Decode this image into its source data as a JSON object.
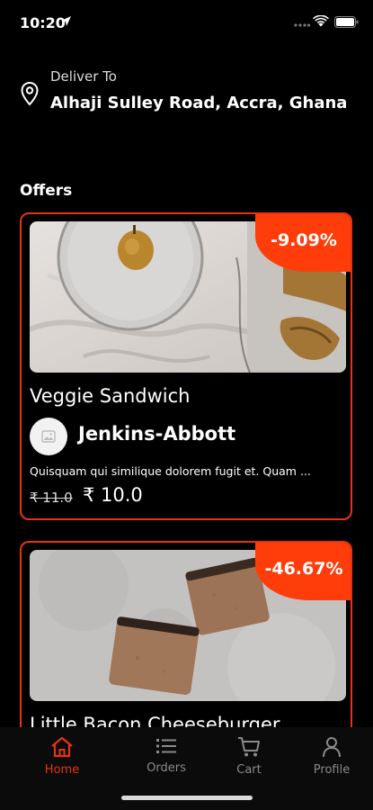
{
  "status": {
    "time": "10:20"
  },
  "deliver": {
    "label": "Deliver To",
    "address": "Alhaji Sulley Road, Accra, Ghana"
  },
  "offers": {
    "title": "Offers",
    "items": [
      {
        "discount": "-9.09%",
        "name": "Veggie Sandwich",
        "vendor": "Jenkins-Abbott",
        "description": "Quisquam qui similique dolorem fugit et. Quam ...",
        "old_price": "₹ 11.0",
        "new_price": "₹ 10.0"
      },
      {
        "discount": "-46.67%",
        "name": "Little Bacon Cheeseburger"
      }
    ]
  },
  "nav": {
    "items": [
      {
        "label": "Home",
        "icon": "home-icon"
      },
      {
        "label": "Orders",
        "icon": "list-icon"
      },
      {
        "label": "Cart",
        "icon": "cart-icon"
      },
      {
        "label": "Profile",
        "icon": "profile-icon"
      }
    ],
    "active": "Home"
  },
  "colors": {
    "accent": "#e8340e",
    "badge": "#ff3d0a",
    "background": "#000000"
  }
}
